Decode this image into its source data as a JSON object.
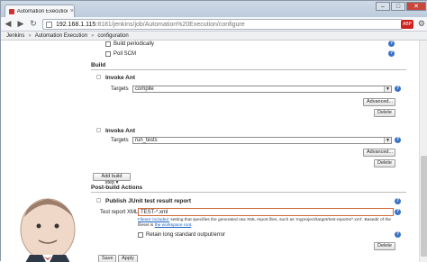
{
  "browser": {
    "tab_title": "Automation Execution Co",
    "tab_close": "×",
    "url_host": "192.168.1.115",
    "url_path": ":8181/jenkins/job/Automation%20Execution/configure",
    "abp_label": "ABP",
    "window_buttons": {
      "min": "–",
      "max": "□",
      "close": "✕"
    },
    "nav": {
      "back": "◀",
      "forward": "▶",
      "reload": "↻"
    },
    "wrench": "⚙"
  },
  "breadcrumbs": [
    "Jenkins",
    "Automation Execution",
    "configuration"
  ],
  "breadcrumb_sep": "»",
  "build_triggers": {
    "build_periodically": "Build periodically",
    "poll_scm": "Poll SCM"
  },
  "build": {
    "section_title": "Build",
    "steps": [
      {
        "title": "Invoke Ant",
        "targets_label": "Targets",
        "targets_value": "compile",
        "advanced": "Advanced...",
        "delete": "Delete"
      },
      {
        "title": "Invoke Ant",
        "targets_label": "Targets",
        "targets_value": "run_tests",
        "advanced": "Advanced...",
        "delete": "Delete"
      }
    ],
    "add_build_step": "Add build step ▾"
  },
  "post_build": {
    "section_title": "Post-build Actions",
    "publisher_title": "Publish JUnit test result report",
    "xml_label": "Test report XMLs",
    "xml_value": "TEST-*.xml",
    "note_link1": "Fileset 'includes'",
    "note_text": " setting that specifies the generated raw XML report files, such as 'myproject/target/test-reports/*.xml'. Basedir of the fileset is ",
    "note_link2": "the workspace root",
    "note_end": ".",
    "retain_label": "Retain long standard output/error",
    "delete": "Delete"
  },
  "footer": {
    "save": "Save",
    "apply": "Apply"
  },
  "help_glyph": "?",
  "colors": {
    "accent": "#3a73c7",
    "error_border": "#d06a3a"
  }
}
